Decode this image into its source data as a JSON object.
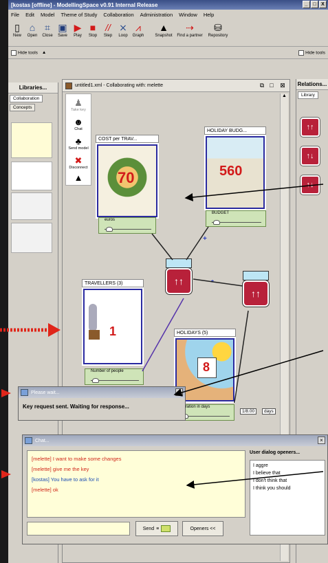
{
  "window": {
    "title": "[kostas [offline] - ModellingSpace v0.91 Internal Release",
    "controls": [
      "_",
      "□",
      "X"
    ]
  },
  "menu": [
    "File",
    "Edit",
    "Model",
    "Theme of Study",
    "Collaboration",
    "Administration",
    "Window",
    "Help"
  ],
  "toolbar": [
    {
      "label": "New",
      "icon": "new-icon"
    },
    {
      "label": "Open",
      "icon": "open-icon"
    },
    {
      "label": "Close",
      "icon": "close-file-icon"
    },
    {
      "label": "Save",
      "icon": "save-icon"
    },
    {
      "label": "Play",
      "icon": "play-icon"
    },
    {
      "label": "Stop",
      "icon": "stop-icon"
    },
    {
      "label": "Step",
      "icon": "step-icon"
    },
    {
      "label": "Loop",
      "icon": "loop-icon"
    },
    {
      "label": "Graph",
      "icon": "graph-icon"
    },
    {
      "label": "Snapshot",
      "icon": "snapshot-icon"
    },
    {
      "label": "Find a partner",
      "icon": "find-partner-icon"
    },
    {
      "label": "Repository",
      "icon": "repository-icon"
    }
  ],
  "hide_tools": "Hide tools",
  "left_panel": {
    "title": "Libraries...",
    "tabs": [
      "Collaboration",
      "Concepts"
    ]
  },
  "canvas_window": {
    "title": "untitled1.xml - Collaborating with: melette"
  },
  "actions": [
    {
      "label": "Take key",
      "icon": "take-key-icon"
    },
    {
      "label": "Chat",
      "icon": "chat-icon"
    },
    {
      "label": "Send model",
      "icon": "send-model-icon"
    },
    {
      "label": "Disconnect",
      "icon": "disconnect-icon"
    }
  ],
  "entities": {
    "cost": {
      "label": "COST per TRAV...",
      "value": "70",
      "property": "euros"
    },
    "holiday_budget": {
      "label": "HOLIDAY BUDG...",
      "value": "560",
      "property": "BUDGET"
    },
    "travellers": {
      "label": "TRAVELLERS (3)",
      "value": "1",
      "property": "Number of people"
    },
    "holidays": {
      "label": "HOLIDAYS (5)",
      "value": "8",
      "property": "Duration in days",
      "unit_value": "1/8.00",
      "unit": "days"
    }
  },
  "operators": {
    "plus": "+",
    "times": "*"
  },
  "right_panel": {
    "title": "Relations...",
    "tab": "Library"
  },
  "key_popup": {
    "title": "Please wait...",
    "message": "Key request sent. Waiting for response..."
  },
  "chat": {
    "title": "Chat...",
    "messages": [
      {
        "text": "[melette] I want to make some changes",
        "color": "#d0271a"
      },
      {
        "text": "[melette] give me the key",
        "color": "#d0271a"
      },
      {
        "text": "[kostas] You have to ask for it",
        "color": "#1a4cb3"
      },
      {
        "text": "[melette] ok",
        "color": "#d0271a"
      }
    ],
    "openers_title": "User dialog openers...",
    "openers": [
      "I aggre",
      "I believe that",
      "I don't think that",
      "I think you should"
    ],
    "send": "Send",
    "openers_button": "Openers <<"
  }
}
